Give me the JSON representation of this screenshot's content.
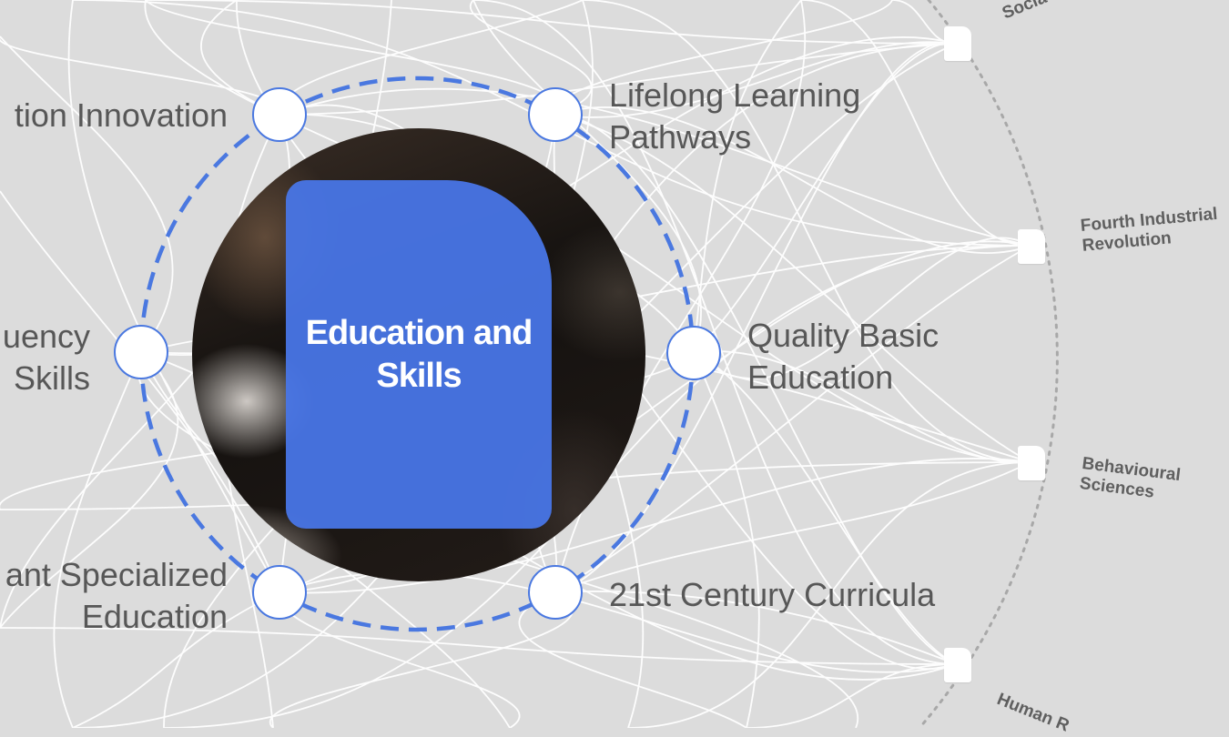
{
  "center": {
    "title": "Education and Skills",
    "image": "students-writing-photo",
    "card_color": "#4a78e6"
  },
  "topics": [
    {
      "id": "innovation",
      "label": "tion Innovation"
    },
    {
      "id": "lifelong",
      "label": "Lifelong Learning Pathways"
    },
    {
      "id": "fluency",
      "label": "uency Skills"
    },
    {
      "id": "basic",
      "label": "Quality Basic Education"
    },
    {
      "id": "specialized",
      "label": "ant Specialized Education"
    },
    {
      "id": "curricula",
      "label": "21st Century Curricula"
    }
  ],
  "topic_lines": {
    "innovation": [
      "tion Innovation"
    ],
    "lifelong": [
      "Lifelong Learning",
      "Pathways"
    ],
    "fluency": [
      "uency",
      "Skills"
    ],
    "basic": [
      "Quality Basic",
      "Education"
    ],
    "specialized": [
      "ant Specialized",
      "Education"
    ],
    "curricula": [
      "21st Century Curricula"
    ]
  },
  "outer_ring": {
    "items": [
      {
        "id": "social",
        "label": "Socia"
      },
      {
        "id": "fourth",
        "label": "Fourth Industrial Revolution",
        "lines": [
          "Fourth Industrial",
          "Revolution"
        ]
      },
      {
        "id": "behavioural",
        "label": "Behavioural Sciences",
        "lines": [
          "Behavioural",
          "Sciences"
        ]
      },
      {
        "id": "human",
        "label": "Human R"
      }
    ]
  },
  "colors": {
    "background": "#dcdcdc",
    "accent": "#4a78e0",
    "connector": "#ffffff",
    "outer_ring": "#a8a8a8",
    "label_text": "#575757"
  }
}
